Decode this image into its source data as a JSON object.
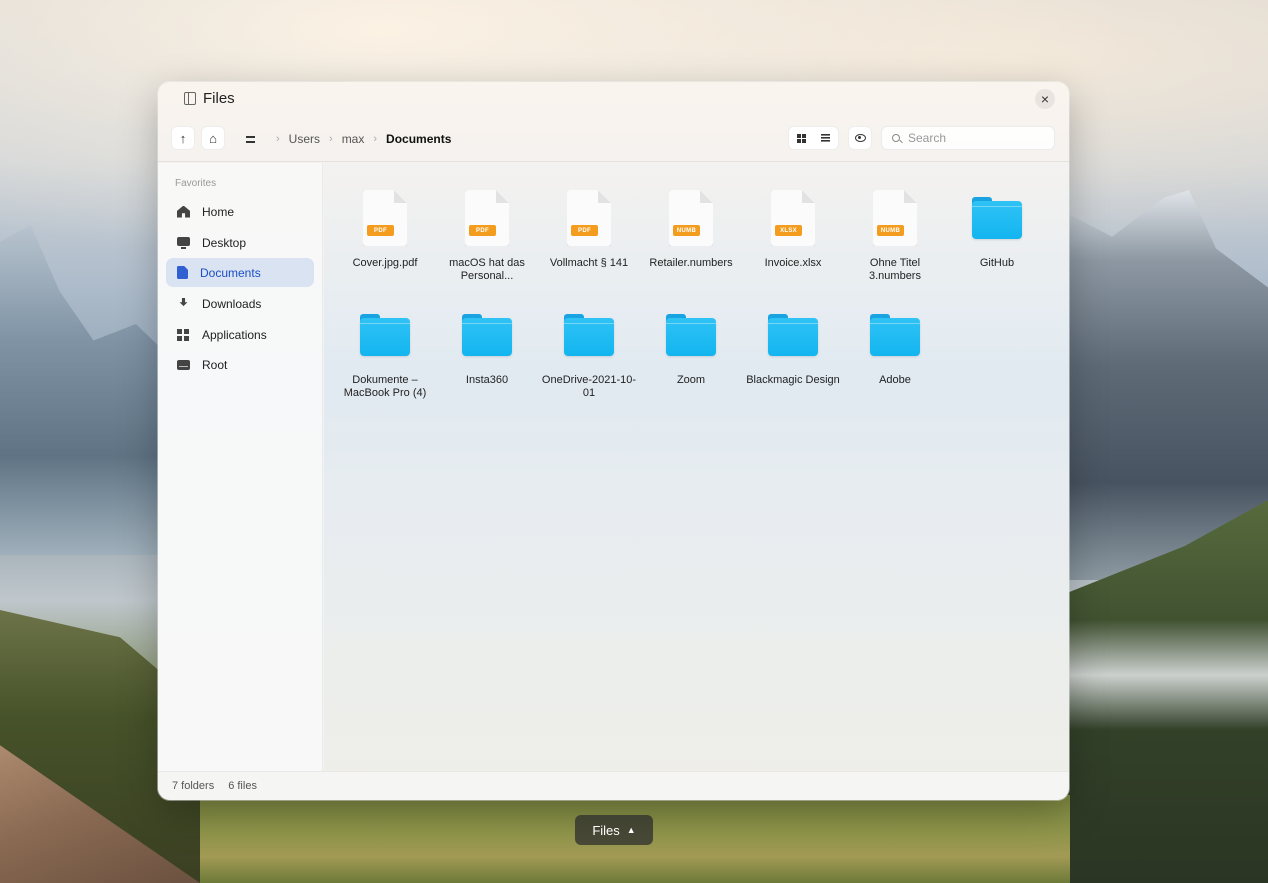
{
  "window": {
    "title": "Files"
  },
  "toolbar": {
    "breadcrumb": [
      "Users",
      "max",
      "Documents"
    ],
    "search_placeholder": "Search"
  },
  "sidebar": {
    "heading": "Favorites",
    "items": [
      {
        "label": "Home",
        "icon": "home-icon"
      },
      {
        "label": "Desktop",
        "icon": "desktop-icon"
      },
      {
        "label": "Documents",
        "icon": "document-icon",
        "active": true
      },
      {
        "label": "Downloads",
        "icon": "download-icon"
      },
      {
        "label": "Applications",
        "icon": "applications-icon"
      },
      {
        "label": "Root",
        "icon": "drive-icon"
      }
    ]
  },
  "files": [
    {
      "name": "Cover.jpg.pdf",
      "kind": "file",
      "badge": "PDF"
    },
    {
      "name": "macOS hat das Personal...",
      "kind": "file",
      "badge": "PDF"
    },
    {
      "name": "Vollmacht § 141",
      "kind": "file",
      "badge": "PDF"
    },
    {
      "name": "Retailer.numbers",
      "kind": "file",
      "badge": "NUMB"
    },
    {
      "name": "Invoice.xlsx",
      "kind": "file",
      "badge": "XLSX"
    },
    {
      "name": "Ohne Titel 3.numbers",
      "kind": "file",
      "badge": "NUMB"
    },
    {
      "name": "GitHub",
      "kind": "folder"
    },
    {
      "name": "Dokumente – MacBook Pro (4)",
      "kind": "folder"
    },
    {
      "name": "Insta360",
      "kind": "folder"
    },
    {
      "name": "OneDrive-2021-10-01",
      "kind": "folder"
    },
    {
      "name": "Zoom",
      "kind": "folder"
    },
    {
      "name": "Blackmagic Design",
      "kind": "folder"
    },
    {
      "name": "Adobe",
      "kind": "folder"
    }
  ],
  "status": {
    "folders": "7 folders",
    "files": "6 files"
  },
  "dock": {
    "label": "Files",
    "arrow": "▲"
  },
  "colors": {
    "accent": "#1b4fc5",
    "folder": "#13b5f0",
    "badge": "#f39c1e"
  }
}
